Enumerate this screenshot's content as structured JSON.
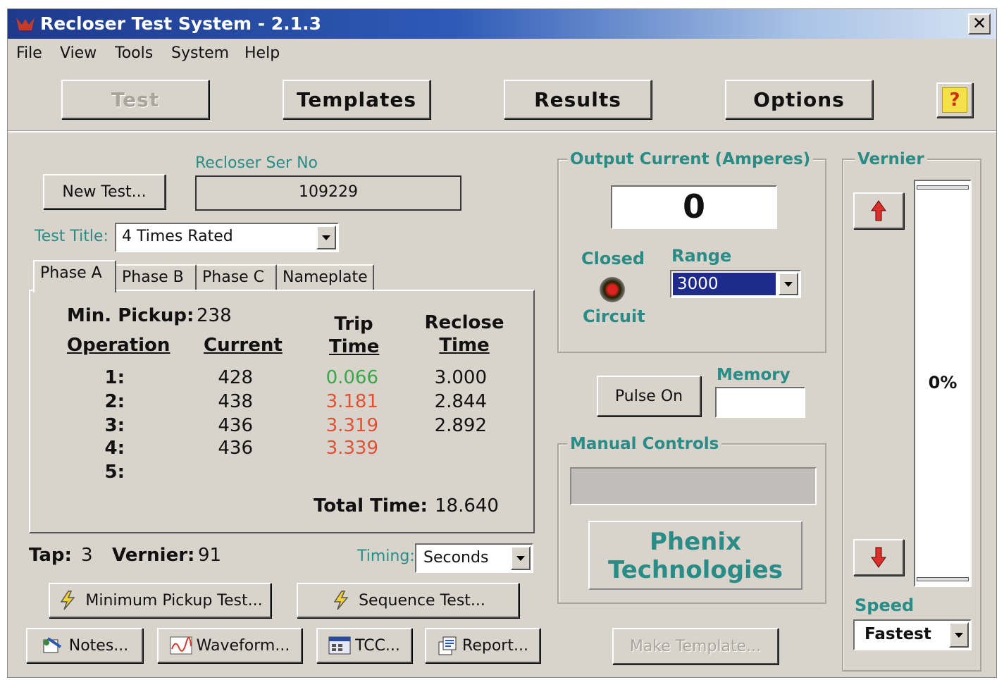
{
  "window": {
    "title": "Recloser Test System - 2.1.3",
    "close_label": "✕"
  },
  "menu": [
    "File",
    "View",
    "Tools",
    "System",
    "Help"
  ],
  "toolbar": {
    "test": "Test",
    "templates": "Templates",
    "results": "Results",
    "options": "Options",
    "help": "?"
  },
  "left": {
    "new_test": "New Test...",
    "ser_no_label": "Recloser Ser No",
    "ser_no_value": "109229",
    "test_title_label": "Test Title:",
    "test_title_value": "4 Times Rated",
    "tabs": [
      "Phase A",
      "Phase B",
      "Phase C",
      "Nameplate"
    ],
    "min_pickup_label": "Min. Pickup:",
    "min_pickup_value": "238",
    "col_operation": "Operation",
    "col_current": "Current",
    "col_trip_1": "Trip",
    "col_trip_2": "Time",
    "col_reclose_1": "Reclose",
    "col_reclose_2": "Time",
    "rows": [
      {
        "op": "1:",
        "current": "428",
        "trip": "0.066",
        "reclose": "3.000"
      },
      {
        "op": "2:",
        "current": "438",
        "trip": "3.181",
        "reclose": "2.844"
      },
      {
        "op": "3:",
        "current": "436",
        "trip": "3.319",
        "reclose": "2.892"
      },
      {
        "op": "4:",
        "current": "436",
        "trip": "3.339",
        "reclose": ""
      },
      {
        "op": "5:",
        "current": "",
        "trip": "",
        "reclose": ""
      }
    ],
    "total_time_label": "Total Time:",
    "total_time_value": "18.640",
    "tap_label": "Tap:",
    "tap_value": "3",
    "vernier_label": "Vernier:",
    "vernier_value": "91",
    "timing_label": "Timing:",
    "timing_value": "Seconds",
    "min_pickup_test": "Minimum Pickup Test...",
    "sequence_test": "Sequence Test...",
    "notes": "Notes...",
    "waveform": "Waveform...",
    "tcc": "TCC...",
    "report": "Report..."
  },
  "output": {
    "group_title": "Output Current (Amperes)",
    "value": "0",
    "closed_label": "Closed",
    "circuit_label": "Circuit",
    "range_label": "Range",
    "range_value": "3000",
    "pulse_on": "Pulse On",
    "memory_label": "Memory",
    "memory_value": ""
  },
  "manual": {
    "group_title": "Manual Controls",
    "brand_line1": "Phenix",
    "brand_line2": "Technologies",
    "make_template": "Make Template..."
  },
  "vernier": {
    "group_title": "Vernier",
    "percent": "0%",
    "level": 0,
    "speed_label": "Speed",
    "speed_value": "Fastest"
  },
  "colors": {
    "teal": "#2a8c86",
    "good": "#36a84a",
    "bad": "#e15234",
    "face": "#d8d4cc",
    "title_bar": "#1e3a8c"
  }
}
